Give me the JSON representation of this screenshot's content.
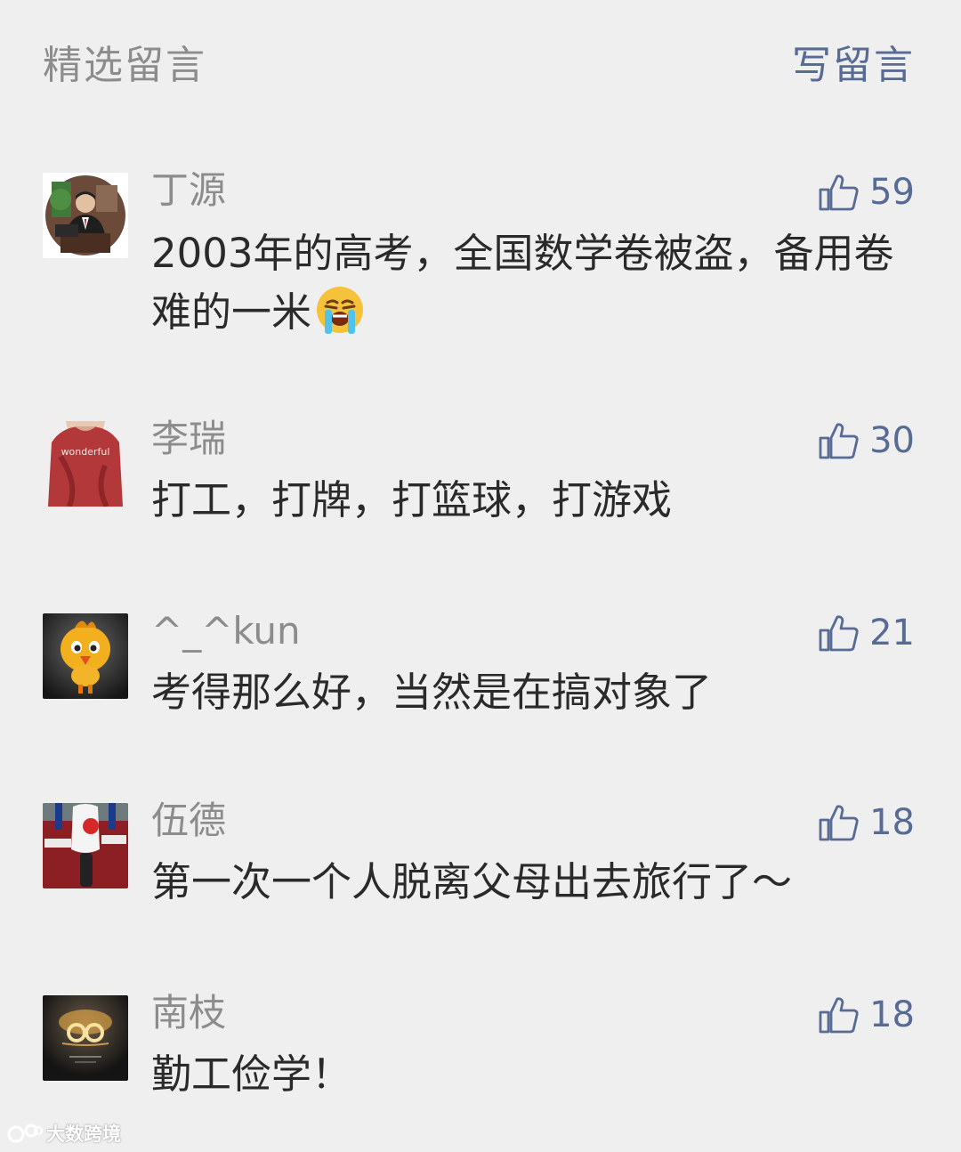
{
  "header": {
    "title": "精选留言",
    "write_label": "写留言"
  },
  "comments": [
    {
      "name": "丁源",
      "likes": "59",
      "content": "2003年的高考，全国数学卷被盗，备用卷难的一米"
    },
    {
      "name": "李瑞",
      "likes": "30",
      "content": "打工，打牌，打篮球，打游戏",
      "avatar_shirt_text": "wonderful"
    },
    {
      "name": "^_^kun",
      "likes": "21",
      "content": "考得那么好，当然是在搞对象了"
    },
    {
      "name": "伍德",
      "likes": "18",
      "content": "第一次一个人脱离父母出去旅行了～"
    },
    {
      "name": "南枝",
      "likes": "18",
      "content": "勤工俭学！"
    }
  ],
  "icons": {
    "like": "thumbs-up-icon",
    "crying_emoji": "loudly-crying-face-icon"
  },
  "watermark": {
    "text": "大数跨境"
  },
  "colors": {
    "background": "#efefef",
    "link": "#576b95",
    "muted": "#8c8c8c",
    "text": "#2a2a2a"
  }
}
